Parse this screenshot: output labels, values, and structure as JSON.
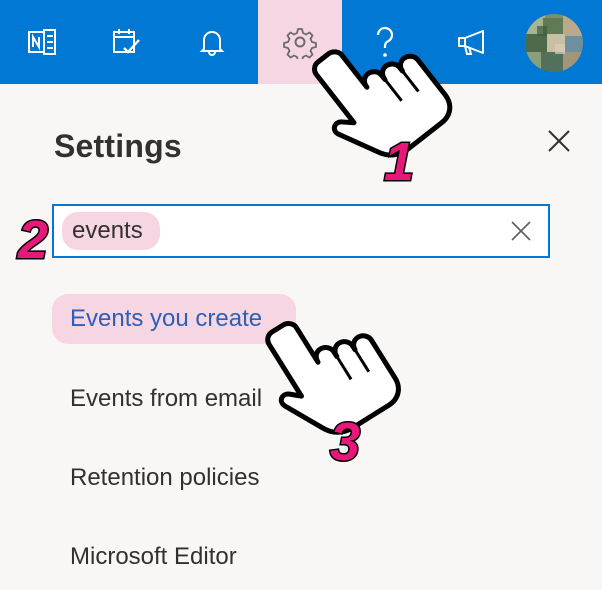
{
  "topbar": {
    "buttons": [
      {
        "name": "onenote-feed-icon",
        "label": "OneNote feed"
      },
      {
        "name": "my-day-icon",
        "label": "My Day"
      },
      {
        "name": "bell-icon",
        "label": "Notifications"
      },
      {
        "name": "gear-icon",
        "label": "Settings",
        "active": true
      },
      {
        "name": "help-icon",
        "label": "Help"
      },
      {
        "name": "megaphone-icon",
        "label": "What's new"
      }
    ],
    "background_color": "#0078d4",
    "active_highlight_color": "#f7d6e3"
  },
  "settings": {
    "title": "Settings",
    "search": {
      "value": "events",
      "placeholder": ""
    },
    "results": [
      {
        "label": "Events you create",
        "highlighted": true
      },
      {
        "label": "Events from email",
        "highlighted": false
      },
      {
        "label": "Retention policies",
        "highlighted": false
      },
      {
        "label": "Microsoft Editor",
        "highlighted": false
      }
    ]
  },
  "steps": [
    "1",
    "2",
    "3"
  ],
  "accent_colors": {
    "link": "#2b5fb8",
    "step": "#e8177a"
  }
}
